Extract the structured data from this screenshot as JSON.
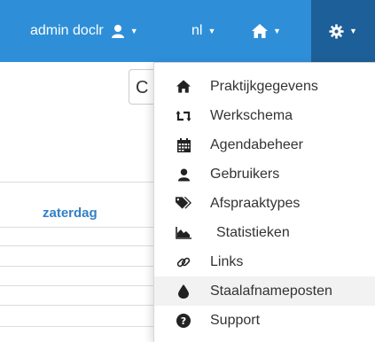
{
  "navbar": {
    "user_label": "admin doclr",
    "language_label": "nl",
    "icons": {
      "user": "user-icon",
      "home": "home-icon",
      "settings": "gear-icon",
      "caret": "caret-down-icon"
    },
    "colors": {
      "bar": "#2e8fd8",
      "active": "#1d5f98"
    }
  },
  "search": {
    "partial_text": "C"
  },
  "calendar": {
    "day_header": "zaterdag",
    "day_color": "#3380c8"
  },
  "menu": {
    "items": [
      {
        "label": "Praktijkgegevens",
        "icon": "home-icon"
      },
      {
        "label": "Werkschema",
        "icon": "retweet-icon"
      },
      {
        "label": "Agendabeheer",
        "icon": "calendar-icon"
      },
      {
        "label": "Gebruikers",
        "icon": "user-icon"
      },
      {
        "label": "Afspraaktypes",
        "icon": "tags-icon"
      },
      {
        "label": "Statistieken",
        "icon": "area-chart-icon"
      },
      {
        "label": "Links",
        "icon": "link-icon"
      },
      {
        "label": "Staalafnameposten",
        "icon": "tint-icon"
      },
      {
        "label": "Support",
        "icon": "question-circle-icon"
      }
    ]
  }
}
